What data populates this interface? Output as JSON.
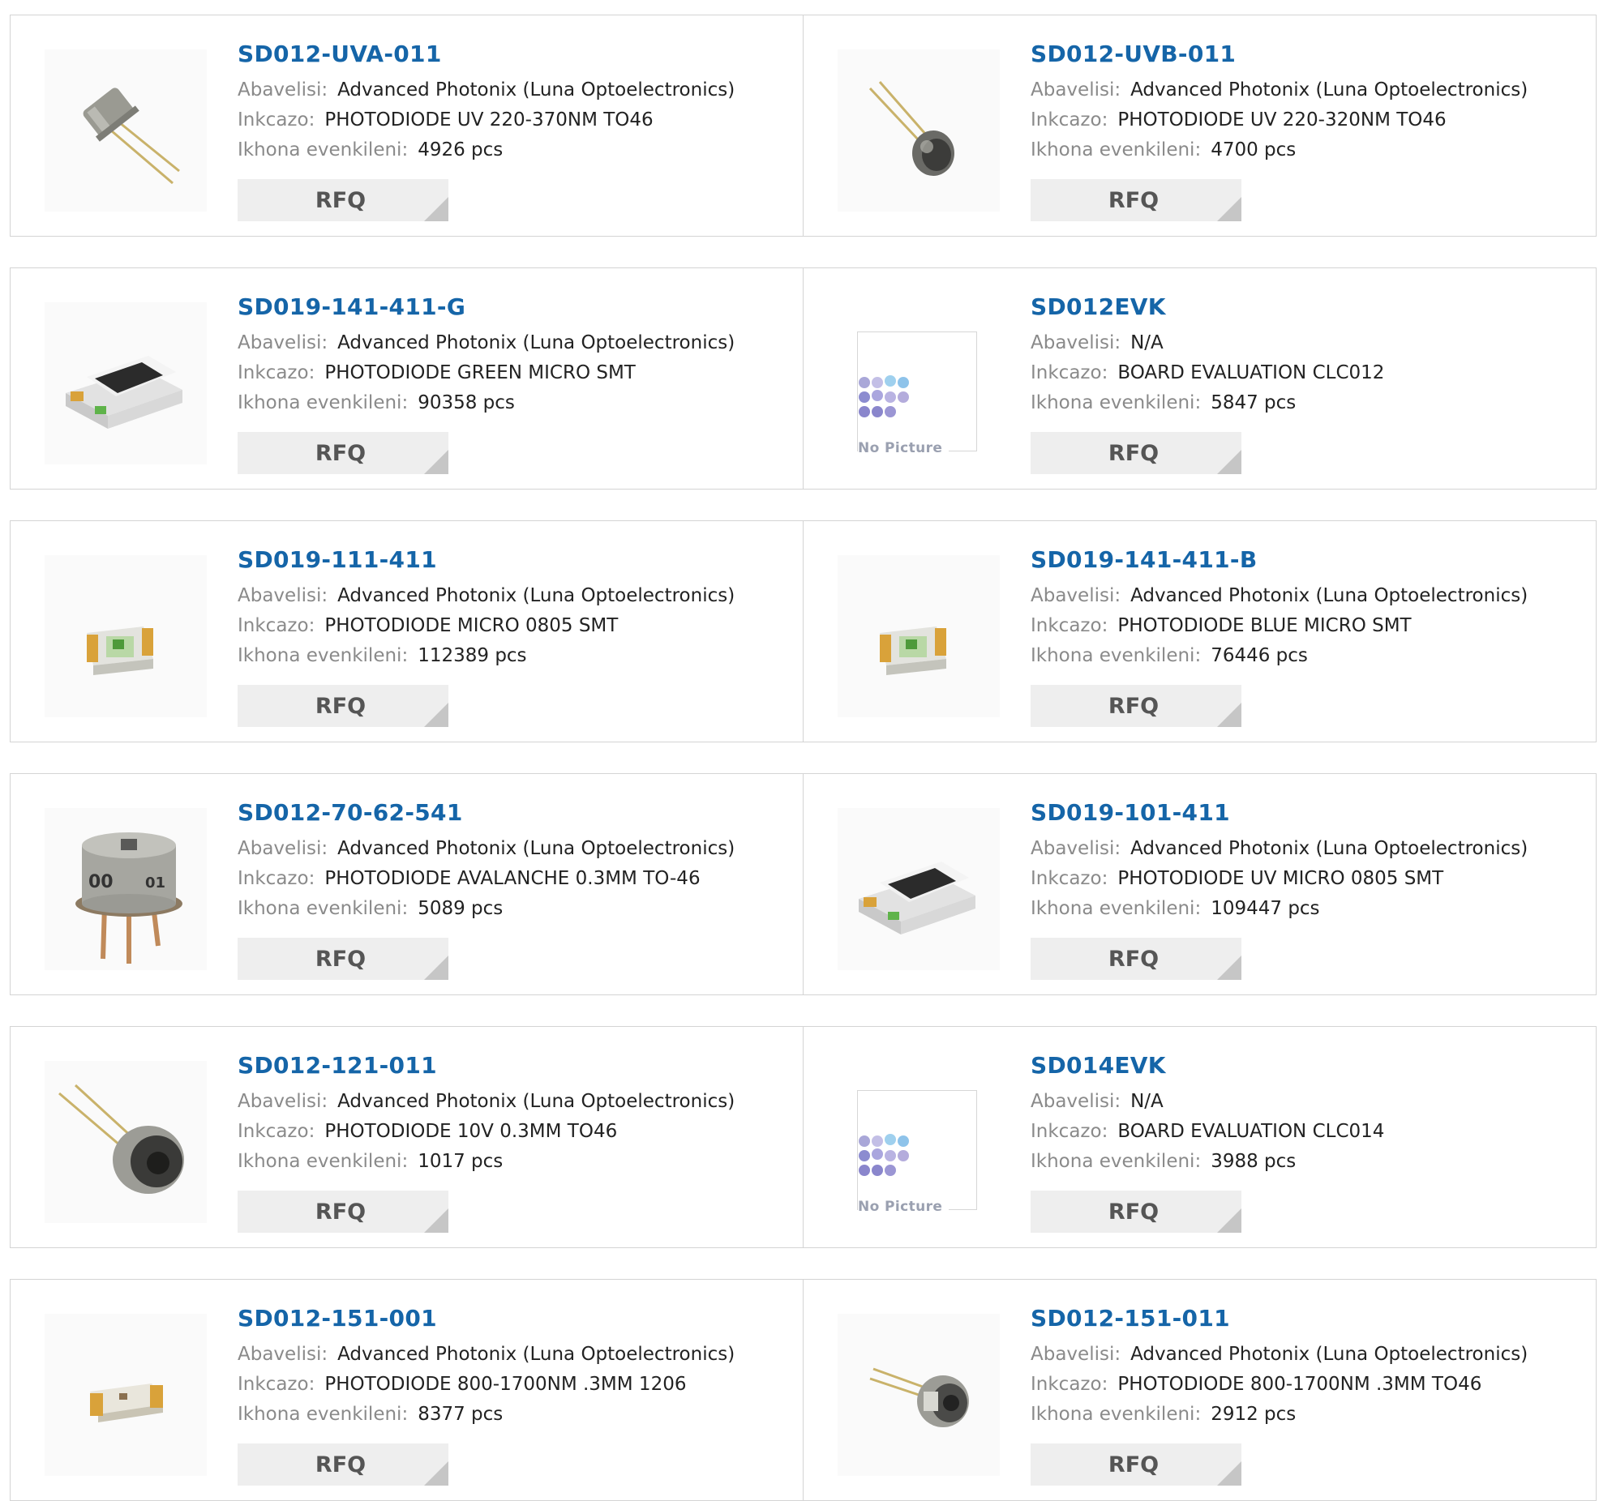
{
  "labels": {
    "manufacturer": "Abavelisi:",
    "description": "Inkcazo:",
    "stock": "Ikhona evenkileni:",
    "rfq": "RFQ",
    "no_picture": "No Picture"
  },
  "products": [
    {
      "part": "SD012-UVA-011",
      "manufacturer": "Advanced Photonix (Luna Optoelectronics)",
      "description": "PHOTODIODE UV 220-370NM TO46",
      "stock": "4926 pcs",
      "image": "to46-side-icon"
    },
    {
      "part": "SD012-UVB-011",
      "manufacturer": "Advanced Photonix (Luna Optoelectronics)",
      "description": "PHOTODIODE UV 220-320NM TO46",
      "stock": "4700 pcs",
      "image": "to46-can-icon"
    },
    {
      "part": "SD019-141-411-G",
      "manufacturer": "Advanced Photonix (Luna Optoelectronics)",
      "description": "PHOTODIODE GREEN MICRO SMT",
      "stock": "90358 pcs",
      "image": "smt-micro-icon"
    },
    {
      "part": "SD012EVK",
      "manufacturer": "N/A",
      "description": "BOARD EVALUATION CLC012",
      "stock": "5847 pcs",
      "image": "no-picture"
    },
    {
      "part": "SD019-111-411",
      "manufacturer": "Advanced Photonix (Luna Optoelectronics)",
      "description": "PHOTODIODE MICRO 0805 SMT",
      "stock": "112389 pcs",
      "image": "smt-0805-icon"
    },
    {
      "part": "SD019-141-411-B",
      "manufacturer": "Advanced Photonix (Luna Optoelectronics)",
      "description": "PHOTODIODE BLUE MICRO SMT",
      "stock": "76446 pcs",
      "image": "smt-0805-icon"
    },
    {
      "part": "SD012-70-62-541",
      "manufacturer": "Advanced Photonix (Luna Optoelectronics)",
      "description": "PHOTODIODE AVALANCHE 0.3MM TO-46",
      "stock": "5089 pcs",
      "image": "to46-large-icon"
    },
    {
      "part": "SD019-101-411",
      "manufacturer": "Advanced Photonix (Luna Optoelectronics)",
      "description": "PHOTODIODE UV MICRO 0805 SMT",
      "stock": "109447 pcs",
      "image": "smt-micro-icon"
    },
    {
      "part": "SD012-121-011",
      "manufacturer": "Advanced Photonix (Luna Optoelectronics)",
      "description": "PHOTODIODE 10V 0.3MM TO46",
      "stock": "1017 pcs",
      "image": "to46-can-icon"
    },
    {
      "part": "SD014EVK",
      "manufacturer": "N/A",
      "description": "BOARD EVALUATION CLC014",
      "stock": "3988 pcs",
      "image": "no-picture"
    },
    {
      "part": "SD012-151-001",
      "manufacturer": "Advanced Photonix (Luna Optoelectronics)",
      "description": "PHOTODIODE 800-1700NM .3MM 1206",
      "stock": "8377 pcs",
      "image": "smt-1206-icon"
    },
    {
      "part": "SD012-151-011",
      "manufacturer": "Advanced Photonix (Luna Optoelectronics)",
      "description": "PHOTODIODE 800-1700NM .3MM TO46",
      "stock": "2912 pcs",
      "image": "to46-can-icon"
    }
  ],
  "colors": {
    "part_link": "#1565a8",
    "label": "#8a8a8a",
    "border": "#d4d4d4",
    "rfq_bg": "#eeeeee"
  }
}
